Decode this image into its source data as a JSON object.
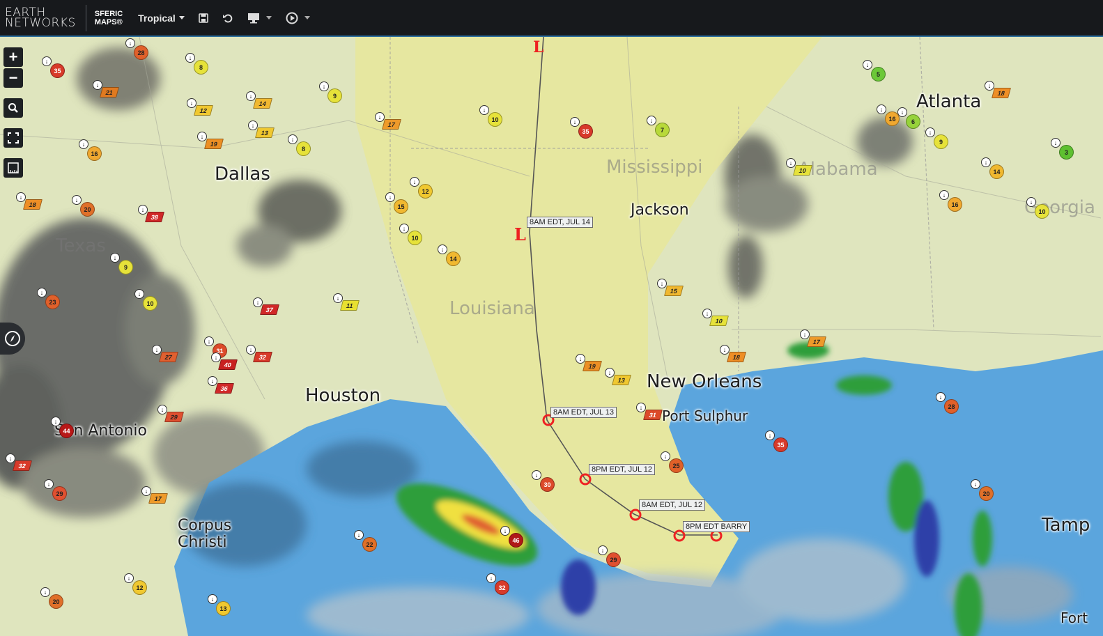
{
  "header": {
    "brand_line1": "EARTH",
    "brand_line2": "NETWORKS",
    "product_line1": "SFERIC",
    "product_line2": "MAPS®",
    "layer_dropdown": "Tropical",
    "save_icon": "floppy-disk-icon",
    "undo_icon": "undo-icon",
    "display_icon": "monitor-icon",
    "play_icon": "play-circle-icon"
  },
  "map_controls": [
    {
      "label": "+",
      "name": "zoom-in-button"
    },
    {
      "label": "−",
      "name": "zoom-out-button"
    },
    {
      "label": "",
      "name": "magnifier-button",
      "icon": "search-icon"
    },
    {
      "label": "",
      "name": "fullscreen-button",
      "icon": "expand-icon"
    },
    {
      "label": "",
      "name": "ruler-button",
      "icon": "ruler-icon"
    }
  ],
  "cities": [
    "Dallas",
    "Houston",
    "San Antonio",
    "Corpus Christi",
    "New Orleans",
    "Port Sulphur",
    "Atlanta",
    "Tamp",
    "Jackson"
  ],
  "states": [
    "Mississippi",
    "Louisiana",
    "Alabama",
    "Texas",
    "Georgia"
  ],
  "track_labels": [
    "8AM EDT, JUL 14",
    "8AM EDT, JUL 13",
    "8PM EDT, JUL 12",
    "8AM EDT, JUL 12",
    "8PM EDT BARRY"
  ],
  "storm_markers": [
    "L",
    "L"
  ],
  "observations": [
    {
      "v": "35",
      "c": "#d83a2a"
    },
    {
      "v": "28",
      "c": "#e0602a"
    },
    {
      "v": "21",
      "c": "#e07a20"
    },
    {
      "v": "8",
      "c": "#e6e23a"
    },
    {
      "v": "12",
      "c": "#f0c830"
    },
    {
      "v": "14",
      "c": "#f0b830"
    },
    {
      "v": "9",
      "c": "#e6e23a"
    },
    {
      "v": "16",
      "c": "#f0a830"
    },
    {
      "v": "19",
      "c": "#ec8f24"
    },
    {
      "v": "13",
      "c": "#f0c830"
    },
    {
      "v": "17",
      "c": "#ee9a2a"
    },
    {
      "v": "18",
      "c": "#ee8e26"
    },
    {
      "v": "10",
      "c": "#e6e23a"
    },
    {
      "v": "7",
      "c": "#b8d93a"
    },
    {
      "v": "5",
      "c": "#6cc838"
    },
    {
      "v": "38",
      "c": "#d02828"
    },
    {
      "v": "20",
      "c": "#e0702a"
    },
    {
      "v": "15",
      "c": "#f0b830"
    },
    {
      "v": "11",
      "c": "#e8e030"
    },
    {
      "v": "23",
      "c": "#e0602a"
    },
    {
      "v": "37",
      "c": "#d02828"
    },
    {
      "v": "27",
      "c": "#e06030"
    },
    {
      "v": "31",
      "c": "#dc4a2a"
    },
    {
      "v": "40",
      "c": "#c82020"
    },
    {
      "v": "32",
      "c": "#d83a2a"
    },
    {
      "v": "36",
      "c": "#d02828"
    },
    {
      "v": "44",
      "c": "#b81818"
    },
    {
      "v": "29",
      "c": "#e05030"
    },
    {
      "v": "22",
      "c": "#e07028"
    },
    {
      "v": "46",
      "c": "#b01818"
    },
    {
      "v": "25",
      "c": "#e06028"
    },
    {
      "v": "30",
      "c": "#dc4a2a"
    },
    {
      "v": "6",
      "c": "#96d23a"
    },
    {
      "v": "3",
      "c": "#5ec030"
    }
  ],
  "partial_labels": [
    "Fort",
    "Georgia"
  ]
}
